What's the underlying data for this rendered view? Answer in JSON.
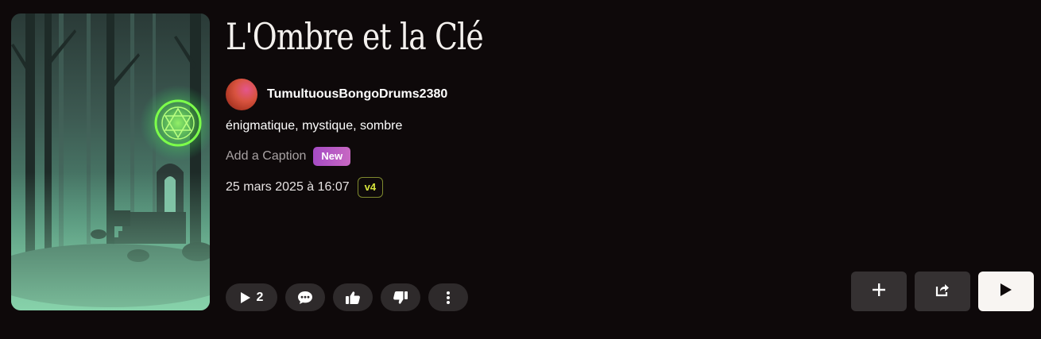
{
  "song": {
    "title": "L'Ombre et la Clé",
    "artist": "TumultuousBongoDrums2380",
    "tags": [
      "énigmatique",
      "mystique",
      "sombre"
    ],
    "caption_placeholder": "Add a Caption",
    "caption_badge": "New",
    "date": "25 mars 2025 à 16:07",
    "version": "v4"
  },
  "actions": {
    "play_count": "2"
  },
  "icons": {
    "play_count": "play-icon",
    "comment": "comment-icon",
    "like": "thumbs-up-icon",
    "dislike": "thumbs-down-icon",
    "more": "more-vertical-icon",
    "add": "plus-icon",
    "share": "share-icon",
    "play": "play-icon"
  },
  "colors": {
    "background": "#0e090a",
    "pill": "#2e2a2b",
    "badge_new": "#b557c4",
    "badge_version": "#d7e53c",
    "play_button": "#f8f5f2"
  }
}
